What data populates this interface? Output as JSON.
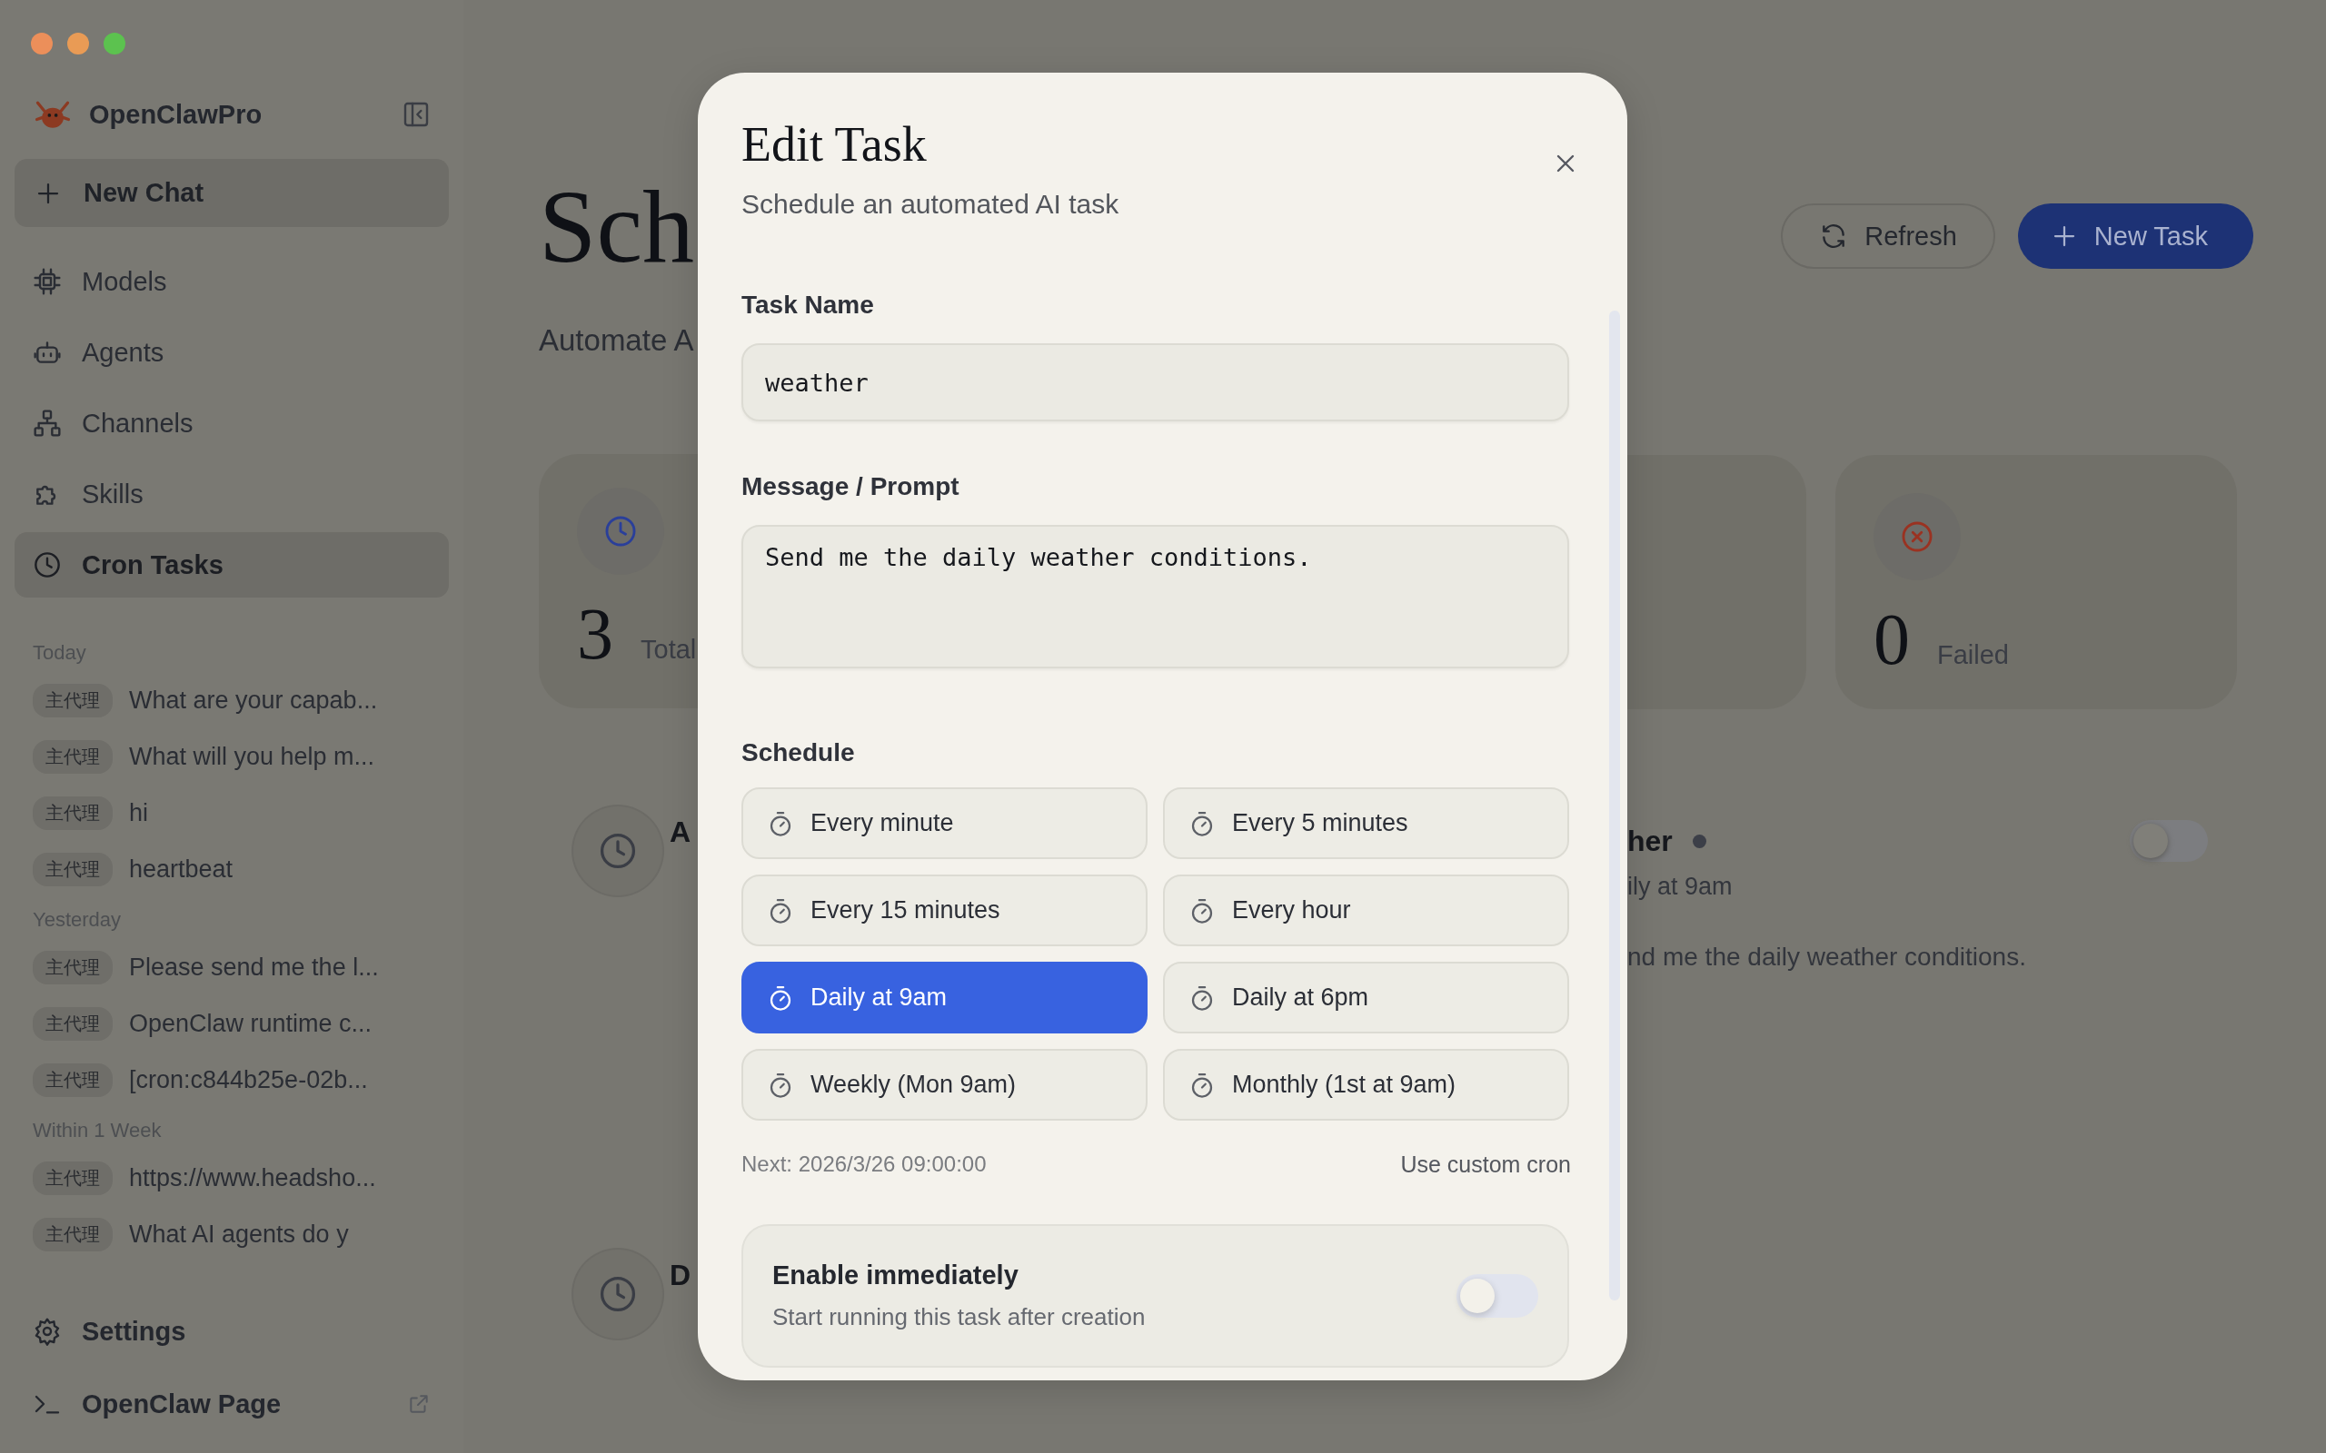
{
  "sidebar": {
    "app_name": "OpenClawPro",
    "new_chat": "New Chat",
    "nav": [
      {
        "label": "Models",
        "selected": false
      },
      {
        "label": "Agents",
        "selected": false
      },
      {
        "label": "Channels",
        "selected": false
      },
      {
        "label": "Skills",
        "selected": false
      },
      {
        "label": "Cron Tasks",
        "selected": true
      }
    ],
    "history": [
      {
        "group": "Today",
        "chats": [
          {
            "tag": "主代理",
            "title": "What are your capab..."
          },
          {
            "tag": "主代理",
            "title": "What will you help m..."
          },
          {
            "tag": "主代理",
            "title": "hi"
          },
          {
            "tag": "主代理",
            "title": "heartbeat"
          }
        ]
      },
      {
        "group": "Yesterday",
        "chats": [
          {
            "tag": "主代理",
            "title": "Please send me the l..."
          },
          {
            "tag": "主代理",
            "title": "OpenClaw runtime c..."
          },
          {
            "tag": "主代理",
            "title": "[cron:c844b25e-02b..."
          }
        ]
      },
      {
        "group": "Within 1 Week",
        "chats": [
          {
            "tag": "主代理",
            "title": "https://www.headsho..."
          },
          {
            "tag": "主代理",
            "title": "What AI agents do y"
          }
        ]
      }
    ],
    "footer": [
      {
        "label": "Settings"
      },
      {
        "label": "OpenClaw Page"
      }
    ]
  },
  "page": {
    "title": "Sch",
    "subtitle": "Automate A",
    "refresh": "Refresh",
    "new_task": "New Task",
    "stats": [
      {
        "kind": "total",
        "value": "3",
        "label": "Total"
      },
      {
        "kind": "failed",
        "value": "0",
        "label": "Failed"
      }
    ],
    "tasks_left": [
      {
        "title": "A"
      },
      {
        "title": "D"
      }
    ],
    "task_right": {
      "title": "her",
      "schedule": "ily at 9am",
      "message": "nd me the daily weather conditions.",
      "enabled": false
    }
  },
  "dialog": {
    "title": "Edit Task",
    "subtitle": "Schedule an automated AI task",
    "fields": [
      {
        "kind": "input",
        "label": "Task Name",
        "value": "weather"
      },
      {
        "kind": "textarea",
        "label": "Message / Prompt",
        "value": "Send me the daily weather conditions."
      }
    ],
    "schedule": {
      "label": "Schedule",
      "presets": [
        {
          "label": "Every minute",
          "selected": false
        },
        {
          "label": "Every 5 minutes",
          "selected": false
        },
        {
          "label": "Every 15 minutes",
          "selected": false
        },
        {
          "label": "Every hour",
          "selected": false
        },
        {
          "label": "Daily at 9am",
          "selected": true
        },
        {
          "label": "Daily at 6pm",
          "selected": false
        },
        {
          "label": "Weekly (Mon 9am)",
          "selected": false
        },
        {
          "label": "Monthly (1st at 9am)",
          "selected": false
        }
      ],
      "next": "Next: 2026/3/26 09:00:00",
      "custom_link": "Use custom cron"
    },
    "enable": {
      "title": "Enable immediately",
      "description": "Start running this task after creation",
      "on": false
    }
  }
}
